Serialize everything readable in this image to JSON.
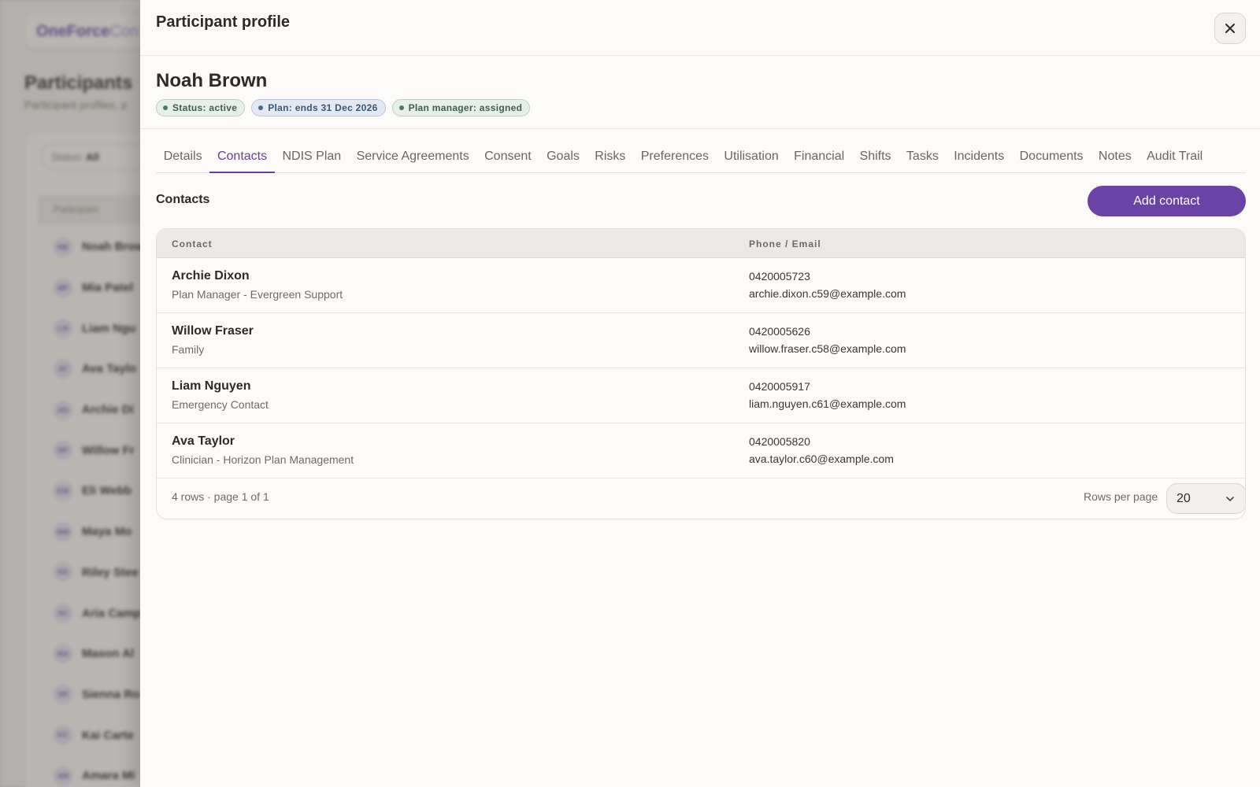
{
  "background": {
    "brand": "OneForce",
    "brand_suffix": "Con",
    "title": "Participants",
    "subtitle": "Participant profiles, p",
    "filter_label": "Status:",
    "filter_value": "All",
    "table_header": "Participant",
    "rows": [
      {
        "initials": "NB",
        "name": "Noah Brow"
      },
      {
        "initials": "MP",
        "name": "Mia Patel"
      },
      {
        "initials": "LN",
        "name": "Liam Ngu"
      },
      {
        "initials": "AT",
        "name": "Ava Taylo"
      },
      {
        "initials": "AD",
        "name": "Archie Di"
      },
      {
        "initials": "WF",
        "name": "Willow Fr"
      },
      {
        "initials": "EW",
        "name": "Eli Webb"
      },
      {
        "initials": "MM",
        "name": "Maya Mo"
      },
      {
        "initials": "RS",
        "name": "Riley Stee"
      },
      {
        "initials": "AC",
        "name": "Aria Camp"
      },
      {
        "initials": "MA",
        "name": "Mason Al"
      },
      {
        "initials": "SR",
        "name": "Sienna Ro"
      },
      {
        "initials": "KC",
        "name": "Kai Carte"
      },
      {
        "initials": "AM",
        "name": "Amara Mi"
      }
    ]
  },
  "drawer": {
    "title": "Participant profile",
    "close_icon": "close-icon",
    "participant_name": "Noah Brown",
    "badges": [
      {
        "label": "Status: active",
        "tone": "green"
      },
      {
        "label": "Plan: ends 31 Dec 2026",
        "tone": "blue"
      },
      {
        "label": "Plan manager: assigned",
        "tone": "green"
      }
    ],
    "tabs": [
      "Details",
      "Contacts",
      "NDIS Plan",
      "Service Agreements",
      "Consent",
      "Goals",
      "Risks",
      "Preferences",
      "Utilisation",
      "Financial",
      "Shifts",
      "Tasks",
      "Incidents",
      "Documents",
      "Notes",
      "Audit Trail"
    ],
    "active_tab": "Contacts",
    "section_title": "Contacts",
    "add_button": "Add contact",
    "table": {
      "columns": [
        "Contact",
        "Phone / Email"
      ],
      "rows": [
        {
          "name": "Archie Dixon",
          "role": "Plan Manager - Evergreen Support",
          "phone": "0420005723",
          "email": "archie.dixon.c59@example.com"
        },
        {
          "name": "Willow Fraser",
          "role": "Family",
          "phone": "0420005626",
          "email": "willow.fraser.c58@example.com"
        },
        {
          "name": "Liam Nguyen",
          "role": "Emergency Contact",
          "phone": "0420005917",
          "email": "liam.nguyen.c61@example.com"
        },
        {
          "name": "Ava Taylor",
          "role": "Clinician - Horizon Plan Management",
          "phone": "0420005820",
          "email": "ava.taylor.c60@example.com"
        }
      ],
      "footer": "4 rows · page 1 of 1",
      "rows_per_page_label": "Rows per page",
      "rows_per_page": "20"
    }
  },
  "colors": {
    "accent": "#6b43a6",
    "badge_green": "#4e7a5d",
    "badge_blue": "#4b6b92"
  }
}
